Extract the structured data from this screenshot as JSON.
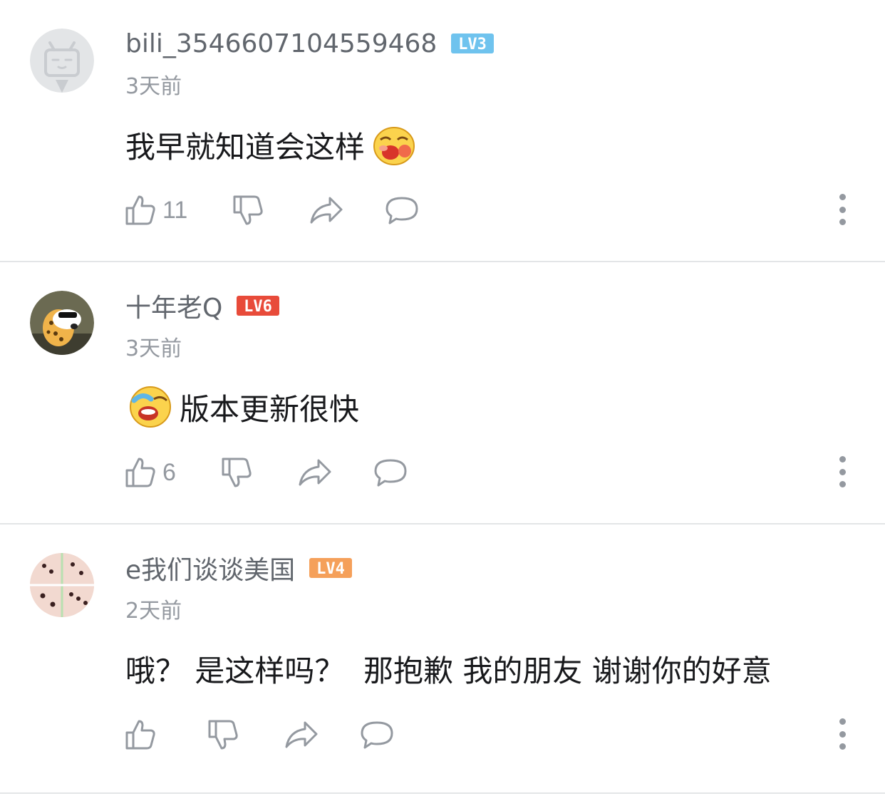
{
  "comments": [
    {
      "username": "bili_3546607104559468",
      "level": "LV3",
      "level_color": "#6fc3ee",
      "time": "3天前",
      "text": "我早就知道会这样",
      "emoji_after": "laughing-sweat-emoji",
      "likes": "11",
      "avatar": "default-tv-avatar"
    },
    {
      "username": "十年老Q",
      "level": "LV6",
      "level_color": "#e84b3a",
      "time": "3天前",
      "text": "版本更新很快",
      "emoji_before": "crying-laughing-emoji",
      "likes": "6",
      "avatar": "cheetah-avatar"
    },
    {
      "username": "e我们谈谈美国",
      "level": "LV4",
      "level_color": "#f5a05a",
      "time": "2天前",
      "text": "哦？ 是这样吗？  那抱歉 我的朋友 谢谢你的好意",
      "likes": "",
      "avatar": "dominoes-avatar"
    }
  ],
  "icons": {
    "like": "thumbs-up-icon",
    "dislike": "thumbs-down-icon",
    "share": "share-icon",
    "reply": "reply-icon",
    "more": "more-vertical-icon"
  }
}
